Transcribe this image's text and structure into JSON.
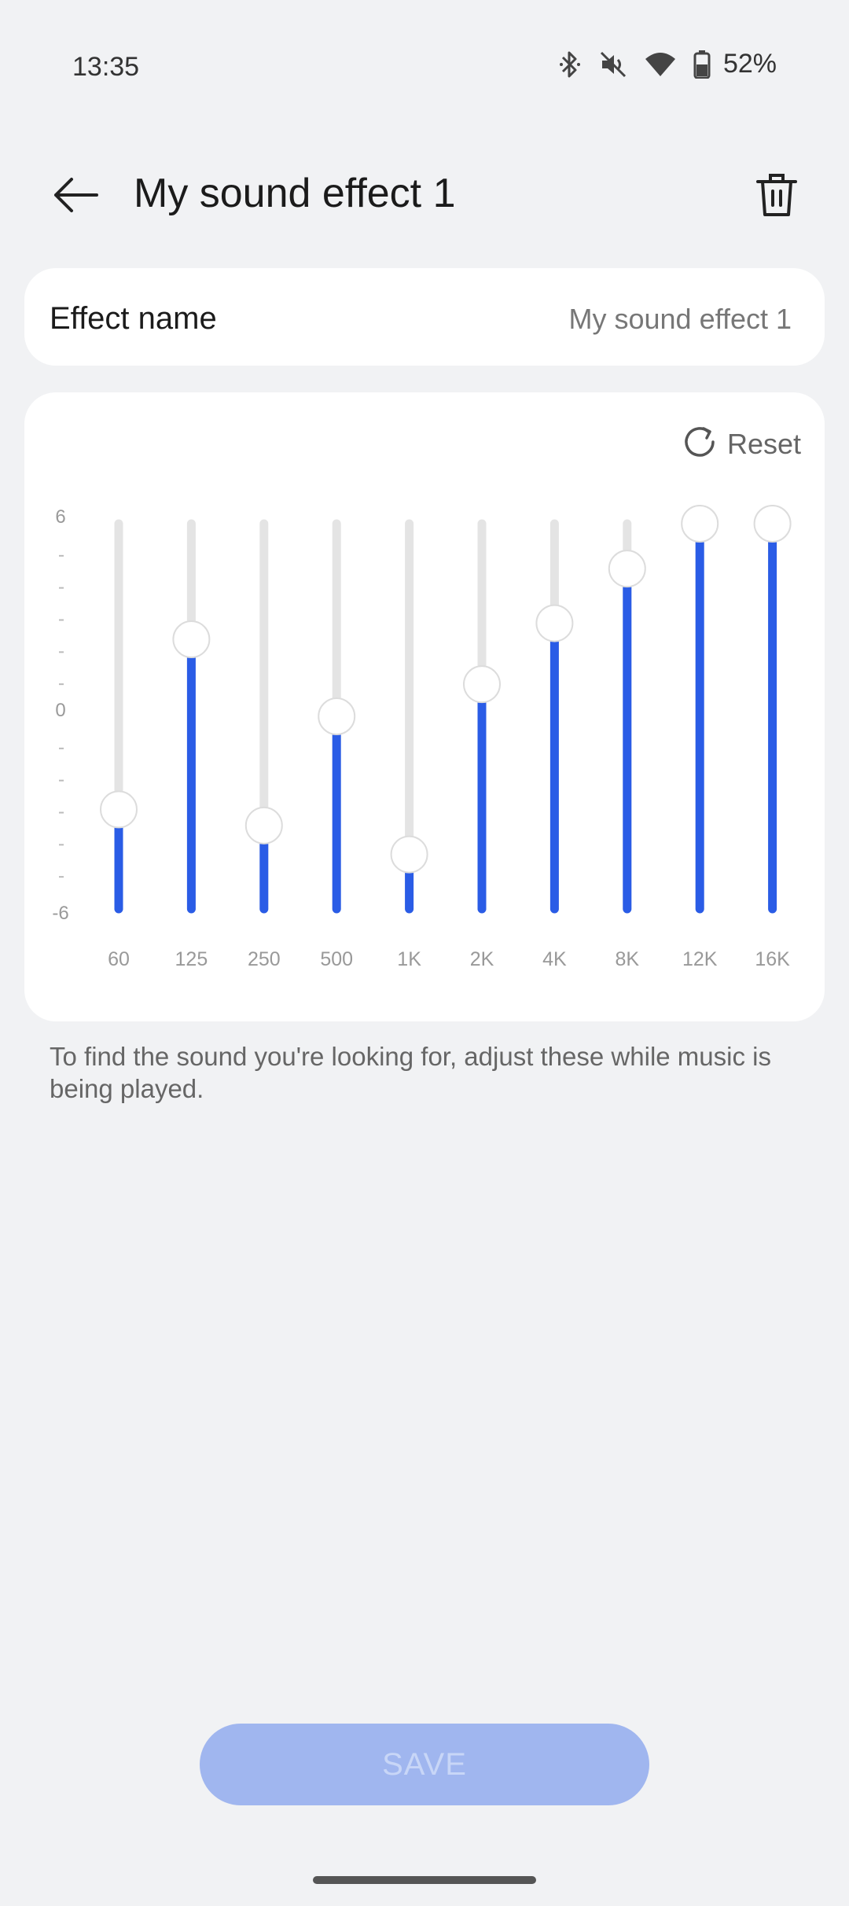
{
  "status_bar": {
    "time": "13:35",
    "battery": "52%"
  },
  "header": {
    "title": "My sound effect 1"
  },
  "effect_name": {
    "label": "Effect name",
    "value": "My sound effect 1"
  },
  "equalizer": {
    "reset_label": "Reset",
    "scale_labels": {
      "top": "6",
      "middle": "0",
      "bottom": "-6"
    },
    "bands": [
      {
        "freq": "60",
        "value": -2.9
      },
      {
        "freq": "125",
        "value": 2.4
      },
      {
        "freq": "250",
        "value": -3.4
      },
      {
        "freq": "500",
        "value": 0.0
      },
      {
        "freq": "1K",
        "value": -4.3
      },
      {
        "freq": "2K",
        "value": 1.0
      },
      {
        "freq": "4K",
        "value": 2.9
      },
      {
        "freq": "8K",
        "value": 4.6
      },
      {
        "freq": "12K",
        "value": 6.0
      },
      {
        "freq": "16K",
        "value": 6.0
      }
    ],
    "colors": {
      "active": "#2a5ce6",
      "track": "#e4e4e4"
    }
  },
  "hint": "To find the sound you're looking for, adjust these while music is being played.",
  "save_button": {
    "label": "SAVE"
  }
}
